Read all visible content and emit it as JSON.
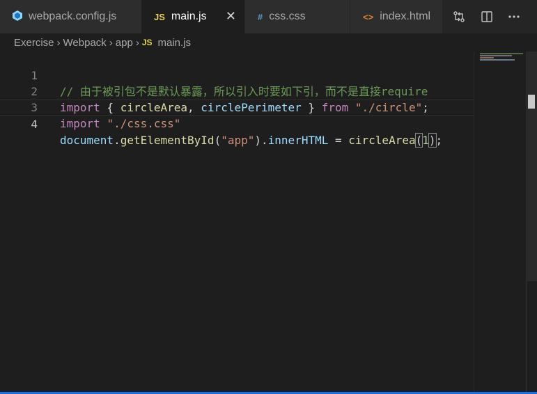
{
  "tabs": [
    {
      "label": "webpack.config.js",
      "icon": "webpack-file-icon",
      "active": false
    },
    {
      "label": "main.js",
      "icon": "js-file-icon",
      "icon_text": "JS",
      "active": true
    },
    {
      "label": "css.css",
      "icon": "css-file-icon",
      "icon_text": "#",
      "active": false
    },
    {
      "label": "index.html",
      "icon": "html-file-icon",
      "icon_text": "<>",
      "active": false
    }
  ],
  "actions": [
    "compare-changes-icon",
    "split-editor-icon",
    "more-actions-icon"
  ],
  "breadcrumb": {
    "items": [
      "Exercise",
      "Webpack",
      "app"
    ],
    "file_icon_text": "JS",
    "file": "main.js"
  },
  "code": {
    "line_numbers": [
      "1",
      "2",
      "3",
      "4"
    ],
    "line1": {
      "comment": "// 由于被引包不是默认暴露，所以引入时要如下引，而不是直接require"
    },
    "line2": {
      "kw_import": "import",
      "brace_open": " { ",
      "name1": "circleArea",
      "comma": ", ",
      "name2": "circlePerimeter",
      "brace_close": " } ",
      "kw_from": "from",
      "space": " ",
      "path": "\"./circle\"",
      "semi": ";"
    },
    "line3": {
      "kw_import": "import",
      "space": " ",
      "path": "\"./css.css\""
    },
    "line4": {
      "obj": "document",
      "dot1": ".",
      "method": "getElementById",
      "paren_open": "(",
      "arg": "\"app\"",
      "paren_close": ")",
      "dot2": ".",
      "prop": "innerHTML",
      "eq": " = ",
      "call": "circleArea",
      "call_open": "(",
      "num": "1",
      "call_close": ")",
      "semi": ";"
    }
  },
  "colors": {
    "editor_bg": "#1e1e1e",
    "tab_bg": "#2d2d2d",
    "comment": "#6a9955",
    "keyword": "#c586c0",
    "function": "#dcdcaa",
    "variable": "#9cdcfe",
    "string": "#ce9178",
    "number": "#b5cea8",
    "js_icon": "#e8d44d",
    "css_icon": "#519aba",
    "html_icon": "#e37933",
    "webpack_icon": "#5fa8d3"
  }
}
